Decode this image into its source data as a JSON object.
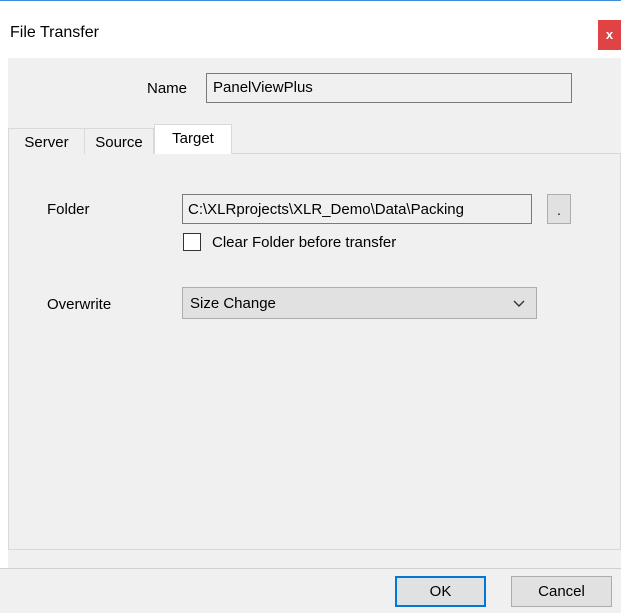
{
  "window": {
    "title": "File Transfer",
    "close_glyph": "x"
  },
  "name": {
    "label": "Name",
    "value": "PanelViewPlus"
  },
  "tabs": [
    {
      "label": "Server"
    },
    {
      "label": "Source"
    },
    {
      "label": "Target",
      "selected": true
    }
  ],
  "target": {
    "folder_label": "Folder",
    "folder_value": "C:\\XLRprojects\\XLR_Demo\\Data\\Packing",
    "browse_label": ".",
    "clear_folder_label": "Clear Folder before transfer",
    "clear_folder_checked": false,
    "overwrite_label": "Overwrite",
    "overwrite_value": "Size Change"
  },
  "buttons": {
    "ok": "OK",
    "cancel": "Cancel"
  },
  "colors": {
    "accent": "#0078d7",
    "close": "#e04343",
    "dialog_bg": "#f0f0f0"
  },
  "icons": {
    "dropdown": "chevron-down-icon"
  }
}
